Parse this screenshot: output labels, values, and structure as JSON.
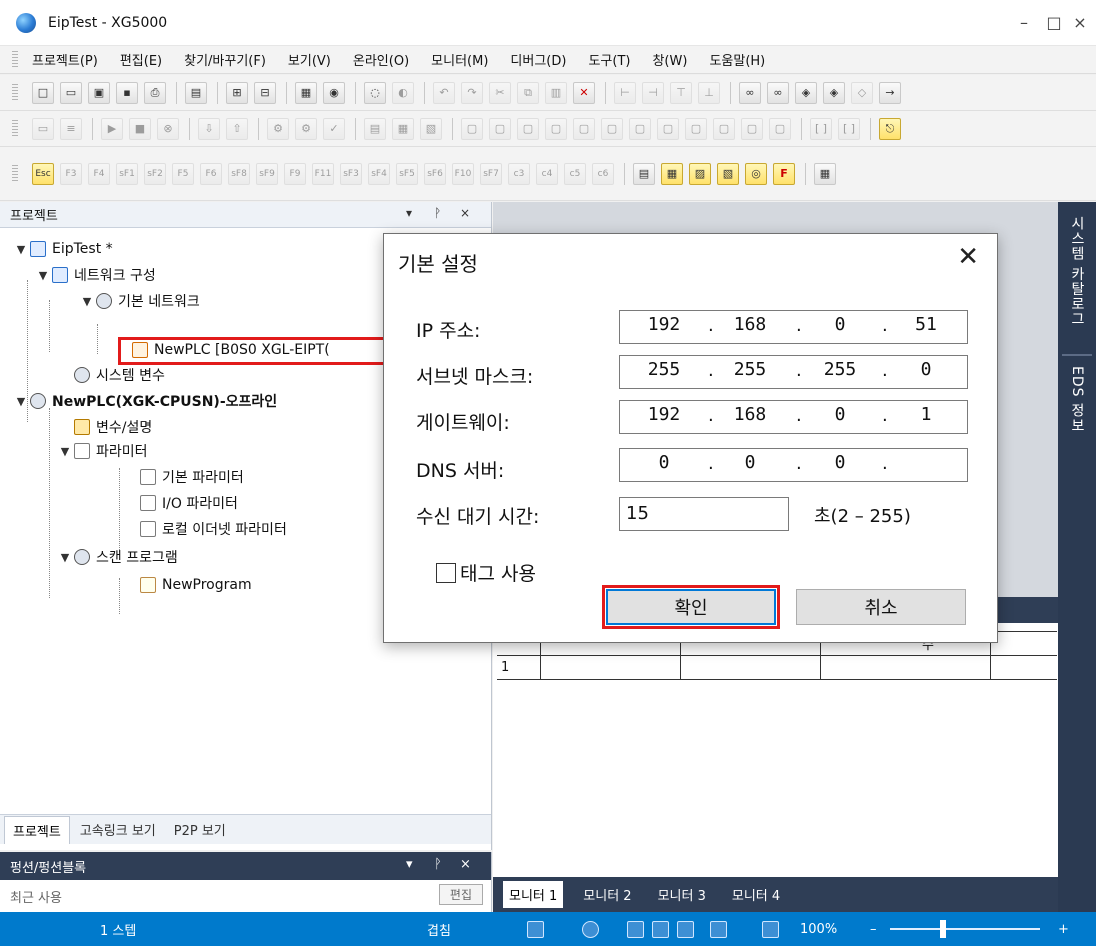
{
  "window": {
    "title": "EipTest - XG5000",
    "minimize": "–",
    "maximize": "□",
    "close": "×"
  },
  "menu": [
    "프로젝트(P)",
    "편집(E)",
    "찾기/바꾸기(F)",
    "보기(V)",
    "온라인(O)",
    "모니터(M)",
    "디버그(D)",
    "도구(T)",
    "창(W)",
    "도움말(H)"
  ],
  "toolbar_keys": [
    "Esc",
    "F3",
    "F4",
    "sF1",
    "sF2",
    "F5",
    "F6",
    "sF8",
    "sF9",
    "F9",
    "F11",
    "sF3",
    "sF4",
    "sF5",
    "sF6",
    "F10",
    "sF7",
    "c3",
    "c4",
    "c5",
    "c6"
  ],
  "project_pane": {
    "title": "프로젝트",
    "pin": "ᚹ",
    "close": "×",
    "tree": {
      "root": "EipTest *",
      "network_config": "네트워크 구성",
      "basic_network": "기본 네트워크",
      "newplc_link": "NewPLC [B0S0 XGL-EIPT(",
      "system_var": "시스템 변수",
      "cpu": "NewPLC(XGK-CPUSN)-오프라인",
      "var_desc": "변수/설명",
      "parameter": "파라미터",
      "basic_param": "기본 파라미터",
      "io_param": "I/O 파라미터",
      "local_eth_param": "로컬 이더넷 파라미터",
      "scan_program": "스캔 프로그램",
      "new_program": "NewProgram"
    },
    "bottom_tabs": [
      "프로젝트",
      "고속링크 보기",
      "P2P 보기"
    ]
  },
  "function_pane": {
    "title": "펑션/펑션블록",
    "recent": "최근 사용",
    "edit": "편집"
  },
  "right_sidebar": [
    "시스템 카탈로그",
    "EDS 정보"
  ],
  "monitor": {
    "header_frag": "수",
    "row1": "1",
    "tabs": [
      "모니터 1",
      "모니터 2",
      "모니터 3",
      "모니터 4"
    ]
  },
  "statusbar": {
    "steps": "1 스텝",
    "mode": "겹침",
    "zoom": "100%",
    "minus": "–",
    "plus": "+"
  },
  "dialog": {
    "title": "기본 설정",
    "close": "✕",
    "ip_label": "IP 주소:",
    "ip": [
      "192",
      "168",
      "0",
      "51"
    ],
    "subnet_label": "서브넷 마스크:",
    "subnet": [
      "255",
      "255",
      "255",
      "0"
    ],
    "gateway_label": "게이트웨이:",
    "gateway": [
      "192",
      "168",
      "0",
      "1"
    ],
    "dns_label": "DNS 서버:",
    "dns": [
      "0",
      "0",
      "0",
      ""
    ],
    "timeout_label": "수신 대기 시간:",
    "timeout_value": "15",
    "timeout_range": "초(2 – 255)",
    "tag_use": "태그 사용",
    "ok": "확인",
    "cancel": "취소"
  },
  "colors": {
    "statusbar": "#007acc",
    "dark_panel": "#2f3e56",
    "highlight": "#e21b1b",
    "focus": "#0078d7"
  }
}
